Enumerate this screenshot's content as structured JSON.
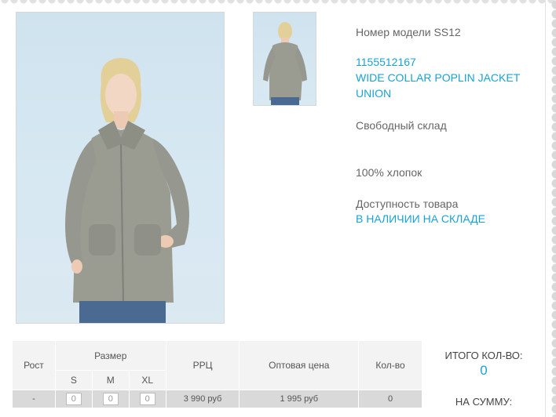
{
  "product": {
    "model_label": "Номер модели SS12",
    "article_number": "1155512167",
    "name_line1": "WIDE COLLAR POPLIN JACKET",
    "name_line2": "UNION",
    "warehouse": "Свободный склад",
    "material": "100% хлопок",
    "availability_label": "Доступность товара",
    "availability_value": "В НАЛИЧИИ НА СКЛАДЕ"
  },
  "images": {
    "main_icon": "product-photo-front",
    "thumb_icon": "product-photo-back"
  },
  "table": {
    "headers": {
      "height": "Рост",
      "size": "Размер",
      "rrp": "РРЦ",
      "wholesale": "Оптовая цена",
      "qty": "Кол-во"
    },
    "sizes": [
      "S",
      "M",
      "XL"
    ],
    "row": {
      "height": "-",
      "qty_s": "0",
      "qty_m": "0",
      "qty_xl": "0",
      "rrp": "3 990 руб",
      "wholesale": "1 995 руб",
      "qty": "0"
    }
  },
  "totals": {
    "total_qty_label": "ИТОГО КОЛ-ВО:",
    "total_qty_value": "0",
    "total_sum_label": "НА СУММУ:"
  },
  "colors": {
    "accent": "#1aa2d6",
    "text": "#666666",
    "table_row": "#d9d9d9"
  }
}
